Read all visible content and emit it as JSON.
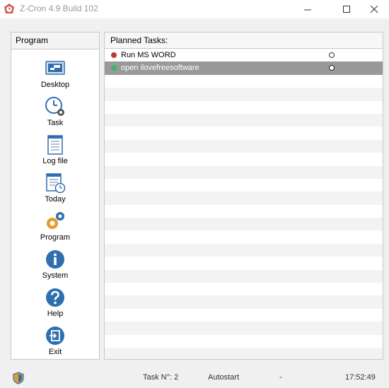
{
  "window": {
    "title": "Z-Cron 4.9 Build 102"
  },
  "sidebar": {
    "header": "Program",
    "items": [
      {
        "label": "Desktop",
        "icon": "desktop-icon"
      },
      {
        "label": "Task",
        "icon": "clock-gear-icon"
      },
      {
        "label": "Log file",
        "icon": "document-icon"
      },
      {
        "label": "Today",
        "icon": "calendar-clock-icon"
      },
      {
        "label": "Program",
        "icon": "gears-icon"
      },
      {
        "label": "System",
        "icon": "info-icon"
      },
      {
        "label": "Help",
        "icon": "help-icon"
      },
      {
        "label": "Exit",
        "icon": "exit-icon"
      }
    ]
  },
  "tasks": {
    "header": "Planned Tasks:",
    "rows": [
      {
        "name": "Run MS WORD",
        "status_color": "#c0392b",
        "selected": false
      },
      {
        "name": "open ilovefreesoftware",
        "status_color": "#3cb371",
        "selected": true
      }
    ]
  },
  "statusbar": {
    "task_count": "Task N°: 2",
    "autostart": "Autostart",
    "separator": "-",
    "time": "17:52:49"
  },
  "colors": {
    "accent_blue": "#2f6fb0",
    "selection": "#999999",
    "gear_orange": "#e69b2a"
  }
}
